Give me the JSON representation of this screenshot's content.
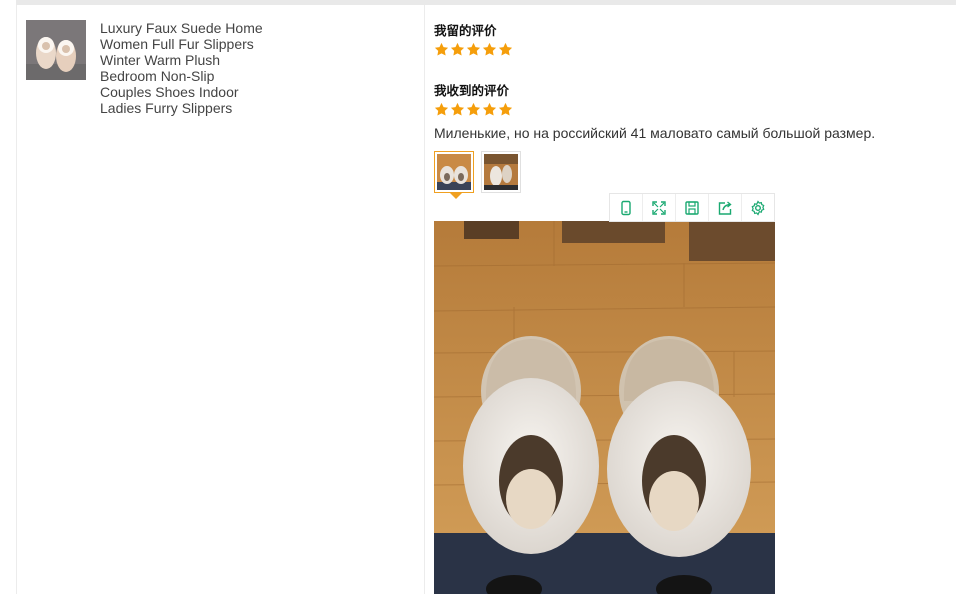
{
  "product": {
    "thumbnail_icon": "slippers-photo",
    "title_lines": [
      "Luxury Faux Suede Home",
      "Women Full Fur Slippers",
      "Winter Warm Plush",
      "Bedroom Non-Slip",
      "Couples Shoes Indoor",
      "Ladies Furry Slippers"
    ]
  },
  "given_review": {
    "label": "我留的评价",
    "rating": 5,
    "rating_max": 5
  },
  "received_review": {
    "label": "我收到的评价",
    "rating": 5,
    "rating_max": 5,
    "text": "Миленькие, но на российский 41 маловато самый большой размер.",
    "photos": [
      {
        "name": "review-photo-1",
        "selected": true
      },
      {
        "name": "review-photo-2",
        "selected": false
      }
    ]
  },
  "viewer_toolbar": {
    "tools": [
      "phone-icon",
      "expand-icon",
      "save-icon",
      "share-icon",
      "settings-icon"
    ]
  },
  "colors": {
    "star": "#f59e0b",
    "accent": "#f0a020",
    "icon": "#1aa971",
    "divider": "#ececec"
  }
}
